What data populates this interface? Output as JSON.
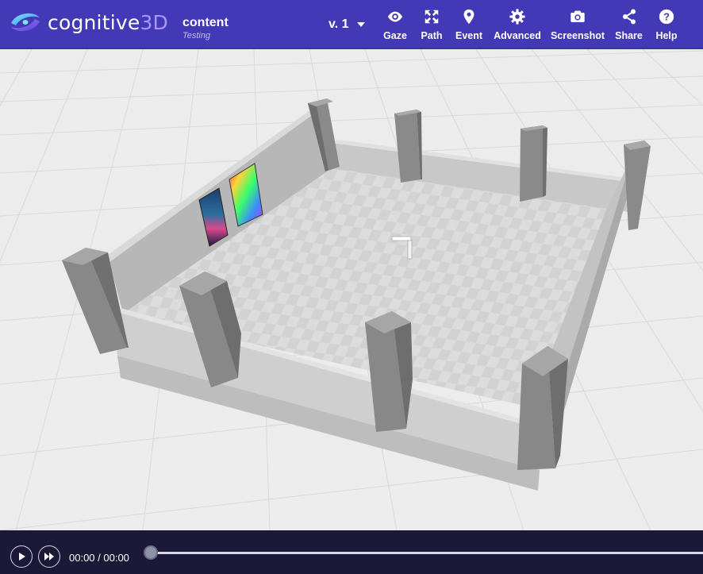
{
  "brand": {
    "name_main": "cognitive",
    "name_accent": "3D",
    "accent_color": "#a996ff"
  },
  "scene": {
    "title": "content",
    "subtitle": "Testing"
  },
  "version": {
    "label": "v. 1"
  },
  "toolbar": [
    {
      "label": "Gaze",
      "icon": "eye-icon"
    },
    {
      "label": "Path",
      "icon": "arrows-expand-icon"
    },
    {
      "label": "Event",
      "icon": "map-pin-icon"
    },
    {
      "label": "Advanced",
      "icon": "gear-icon"
    },
    {
      "label": "Screenshot",
      "icon": "camera-icon"
    },
    {
      "label": "Share",
      "icon": "share-icon"
    },
    {
      "label": "Help",
      "icon": "help-icon"
    }
  ],
  "player": {
    "time": "00:00 / 00:00",
    "progress": 0
  },
  "colors": {
    "topbar": "#4338b5",
    "player_bar": "#1b1838",
    "floor_grid": "#ececec"
  }
}
